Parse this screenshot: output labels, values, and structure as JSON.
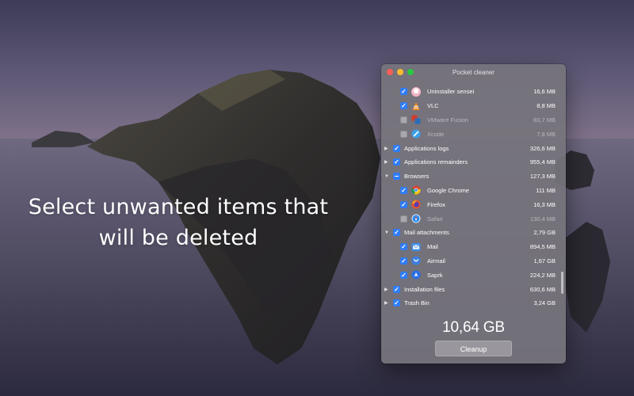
{
  "caption": {
    "line1": "Select unwanted items that",
    "line2": "will be deleted"
  },
  "window": {
    "title": "Pocket cleaner"
  },
  "items": [
    {
      "kind": "child",
      "label": "Uninstaller sensei",
      "size": "16,6 MB",
      "checked": "on",
      "icon": "uninstaller-sensei-icon",
      "dim": false
    },
    {
      "kind": "child",
      "label": "VLC",
      "size": "8,8 MB",
      "checked": "on",
      "icon": "vlc-icon",
      "dim": false
    },
    {
      "kind": "child",
      "label": "VMware Fusion",
      "size": "83,7 MB",
      "checked": "off",
      "icon": "vmware-fusion-icon",
      "dim": true
    },
    {
      "kind": "child",
      "label": "Xcode",
      "size": "7,8 MB",
      "checked": "off",
      "icon": "xcode-icon",
      "dim": true
    },
    {
      "kind": "group",
      "label": "Applications logs",
      "size": "326,6 MB",
      "checked": "on",
      "expanded": false
    },
    {
      "kind": "group",
      "label": "Applications remainders",
      "size": "955,4 MB",
      "checked": "on",
      "expanded": false
    },
    {
      "kind": "group",
      "label": "Browsers",
      "size": "127,3 MB",
      "checked": "mixed",
      "expanded": true
    },
    {
      "kind": "child",
      "label": "Google Chrome",
      "size": "111 MB",
      "checked": "on",
      "icon": "chrome-icon",
      "dim": false
    },
    {
      "kind": "child",
      "label": "Firefox",
      "size": "16,3 MB",
      "checked": "on",
      "icon": "firefox-icon",
      "dim": false
    },
    {
      "kind": "child",
      "label": "Safari",
      "size": "130,4 MB",
      "checked": "off",
      "icon": "safari-icon",
      "dim": true
    },
    {
      "kind": "group",
      "label": "Mail attachments",
      "size": "2,79 GB",
      "checked": "on",
      "expanded": true
    },
    {
      "kind": "child",
      "label": "Mail",
      "size": "894,5 MB",
      "checked": "on",
      "icon": "mail-icon",
      "dim": false
    },
    {
      "kind": "child",
      "label": "Airmail",
      "size": "1,67 GB",
      "checked": "on",
      "icon": "airmail-icon",
      "dim": false
    },
    {
      "kind": "child",
      "label": "Saprk",
      "size": "224,2 MB",
      "checked": "on",
      "icon": "spark-icon",
      "dim": false
    },
    {
      "kind": "group",
      "label": "Installation files",
      "size": "630,6 MB",
      "checked": "on",
      "expanded": false
    },
    {
      "kind": "group",
      "label": "Trash Bin",
      "size": "3,24 GB",
      "checked": "on",
      "expanded": false
    }
  ],
  "total": "10,64 GB",
  "cleanup_label": "Cleanup",
  "colors": {
    "accent": "#2f7cf6",
    "close": "#fc5f57",
    "minimize": "#fdbc2e",
    "maximize": "#29c840"
  }
}
